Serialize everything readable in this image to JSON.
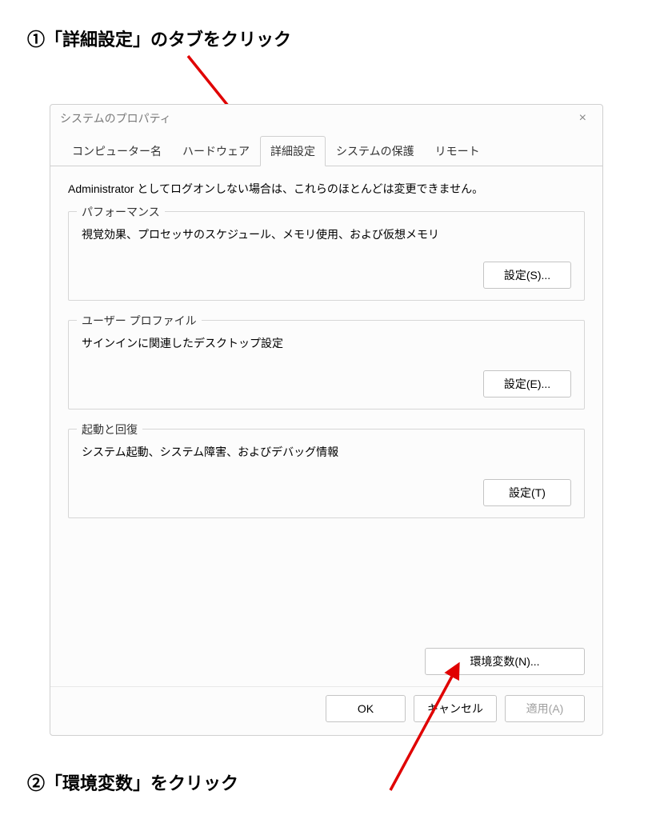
{
  "annotations": {
    "step1": "①「詳細設定」のタブをクリック",
    "step2": "②「環境変数」をクリック"
  },
  "dialog": {
    "title": "システムのプロパティ",
    "close_label": "×"
  },
  "tabs": {
    "computer_name": "コンピューター名",
    "hardware": "ハードウェア",
    "advanced": "詳細設定",
    "system_protection": "システムの保護",
    "remote": "リモート"
  },
  "content": {
    "admin_note": "Administrator としてログオンしない場合は、これらのほとんどは変更できません。"
  },
  "performance": {
    "legend": "パフォーマンス",
    "desc": "視覚効果、プロセッサのスケジュール、メモリ使用、および仮想メモリ",
    "button": "設定(S)..."
  },
  "user_profile": {
    "legend": "ユーザー プロファイル",
    "desc": "サインインに関連したデスクトップ設定",
    "button": "設定(E)..."
  },
  "startup": {
    "legend": "起動と回復",
    "desc": "システム起動、システム障害、およびデバッグ情報",
    "button": "設定(T)"
  },
  "env_button": "環境変数(N)...",
  "footer": {
    "ok": "OK",
    "cancel": "キャンセル",
    "apply": "適用(A)"
  }
}
